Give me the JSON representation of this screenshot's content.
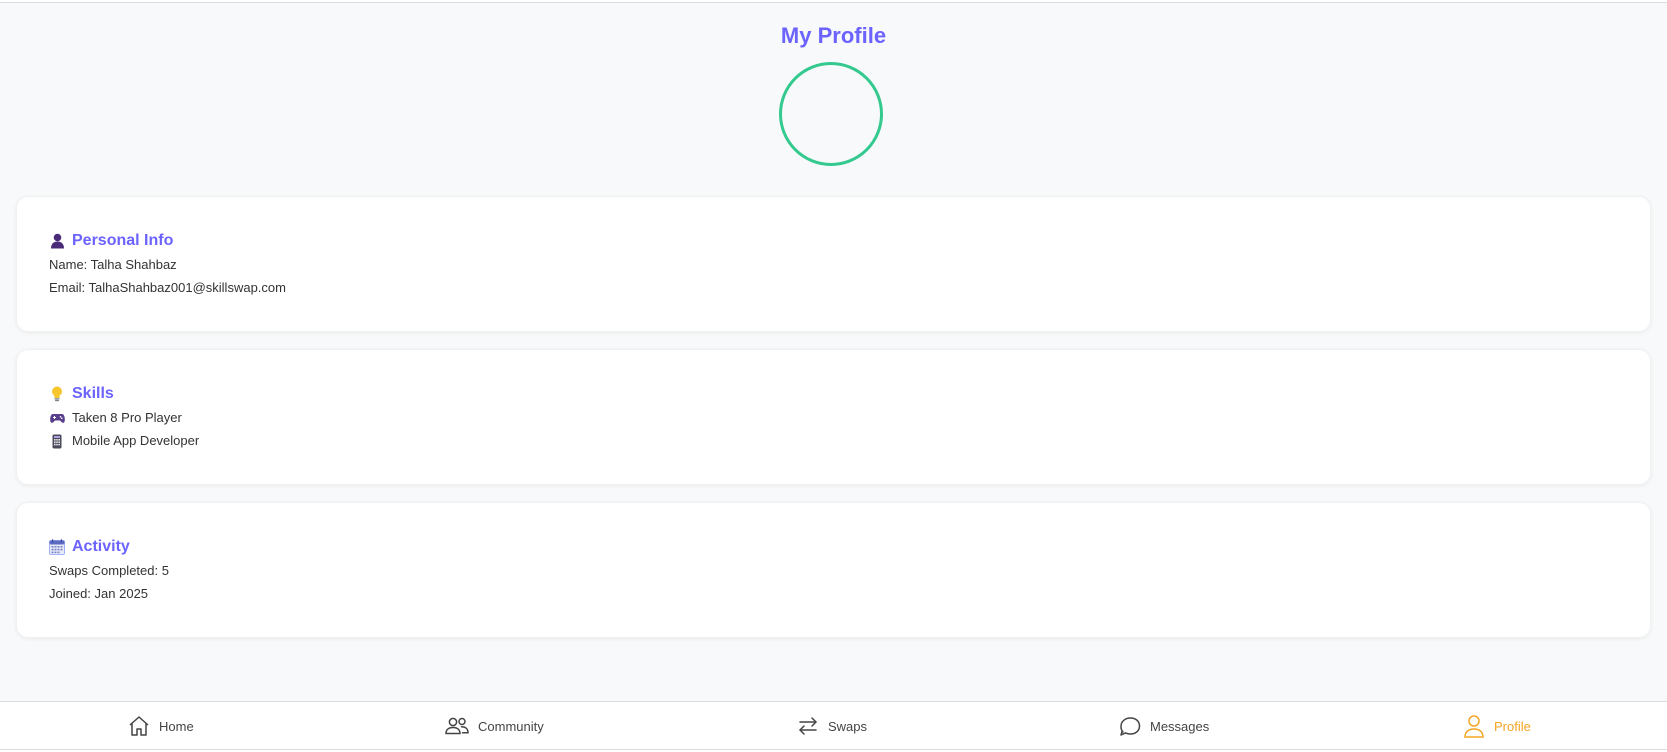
{
  "header": {
    "title": "My Profile"
  },
  "personal_info": {
    "icon": "person-emoji-icon",
    "heading": "Personal Info",
    "name_line": "Name: Talha Shahbaz",
    "email_line": "Email: TalhaShahbaz001@skillswap.com"
  },
  "skills": {
    "icon": "lightbulb-emoji-icon",
    "heading": "Skills",
    "items": [
      {
        "icon": "game-controller-emoji-icon",
        "label": "Taken 8 Pro Player"
      },
      {
        "icon": "mobile-phone-emoji-icon",
        "label": "Mobile App Developer"
      }
    ]
  },
  "activity": {
    "icon": "calendar-emoji-icon",
    "heading": "Activity",
    "swaps_line": "Swaps Completed: 5",
    "joined_line": "Joined: Jan 2025"
  },
  "bottom_nav": {
    "items": [
      {
        "label": "Home",
        "icon": "home-icon"
      },
      {
        "label": "Community",
        "icon": "users-icon"
      },
      {
        "label": "Swaps",
        "icon": "swap-arrows-icon"
      },
      {
        "label": "Messages",
        "icon": "chat-bubble-icon"
      },
      {
        "label": "Profile",
        "icon": "user-icon",
        "active": true
      }
    ]
  },
  "colors": {
    "accent": "#6c63ff",
    "avatar_ring": "#34c98e",
    "active_nav": "#f5a524",
    "background": "#f8f9fa"
  }
}
